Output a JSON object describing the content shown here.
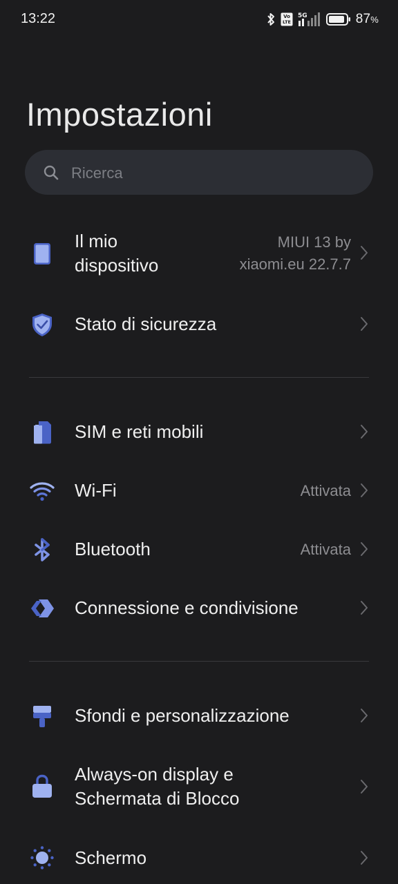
{
  "status_bar": {
    "time": "13:22",
    "network": "5G",
    "volte": "Vo LTE",
    "battery_percent": "87",
    "battery_unit": "%"
  },
  "title": "Impostazioni",
  "search": {
    "placeholder": "Ricerca"
  },
  "rows": {
    "device": {
      "label": "Il mio dispositivo",
      "label_line1": "Il mio",
      "label_line2": "dispositivo",
      "value_line1": "MIUI 13 by",
      "value_line2": "xiaomi.eu 22.7.7",
      "icon": "device-icon"
    },
    "security": {
      "label": "Stato di sicurezza",
      "icon": "shield-check-icon"
    },
    "sim": {
      "label": "SIM e reti mobili",
      "icon": "sim-card-icon"
    },
    "wifi": {
      "label": "Wi-Fi",
      "value": "Attivata",
      "icon": "wifi-icon"
    },
    "bluetooth": {
      "label": "Bluetooth",
      "value": "Attivata",
      "icon": "bluetooth-icon"
    },
    "connection": {
      "label": "Connessione e condivisione",
      "icon": "share-connection-icon"
    },
    "wallpaper": {
      "label": "Sfondi e personalizzazione",
      "icon": "paint-roller-icon"
    },
    "aod": {
      "label": "Always-on display e Schermata di Blocco",
      "label_line1": "Always-on display e",
      "label_line2": "Schermata di Blocco",
      "icon": "lock-icon"
    },
    "display": {
      "label": "Schermo",
      "icon": "brightness-icon"
    }
  },
  "colors": {
    "background": "#1c1c1e",
    "icon_accent": "#7e93e6",
    "icon_dark": "#4a63c6"
  }
}
